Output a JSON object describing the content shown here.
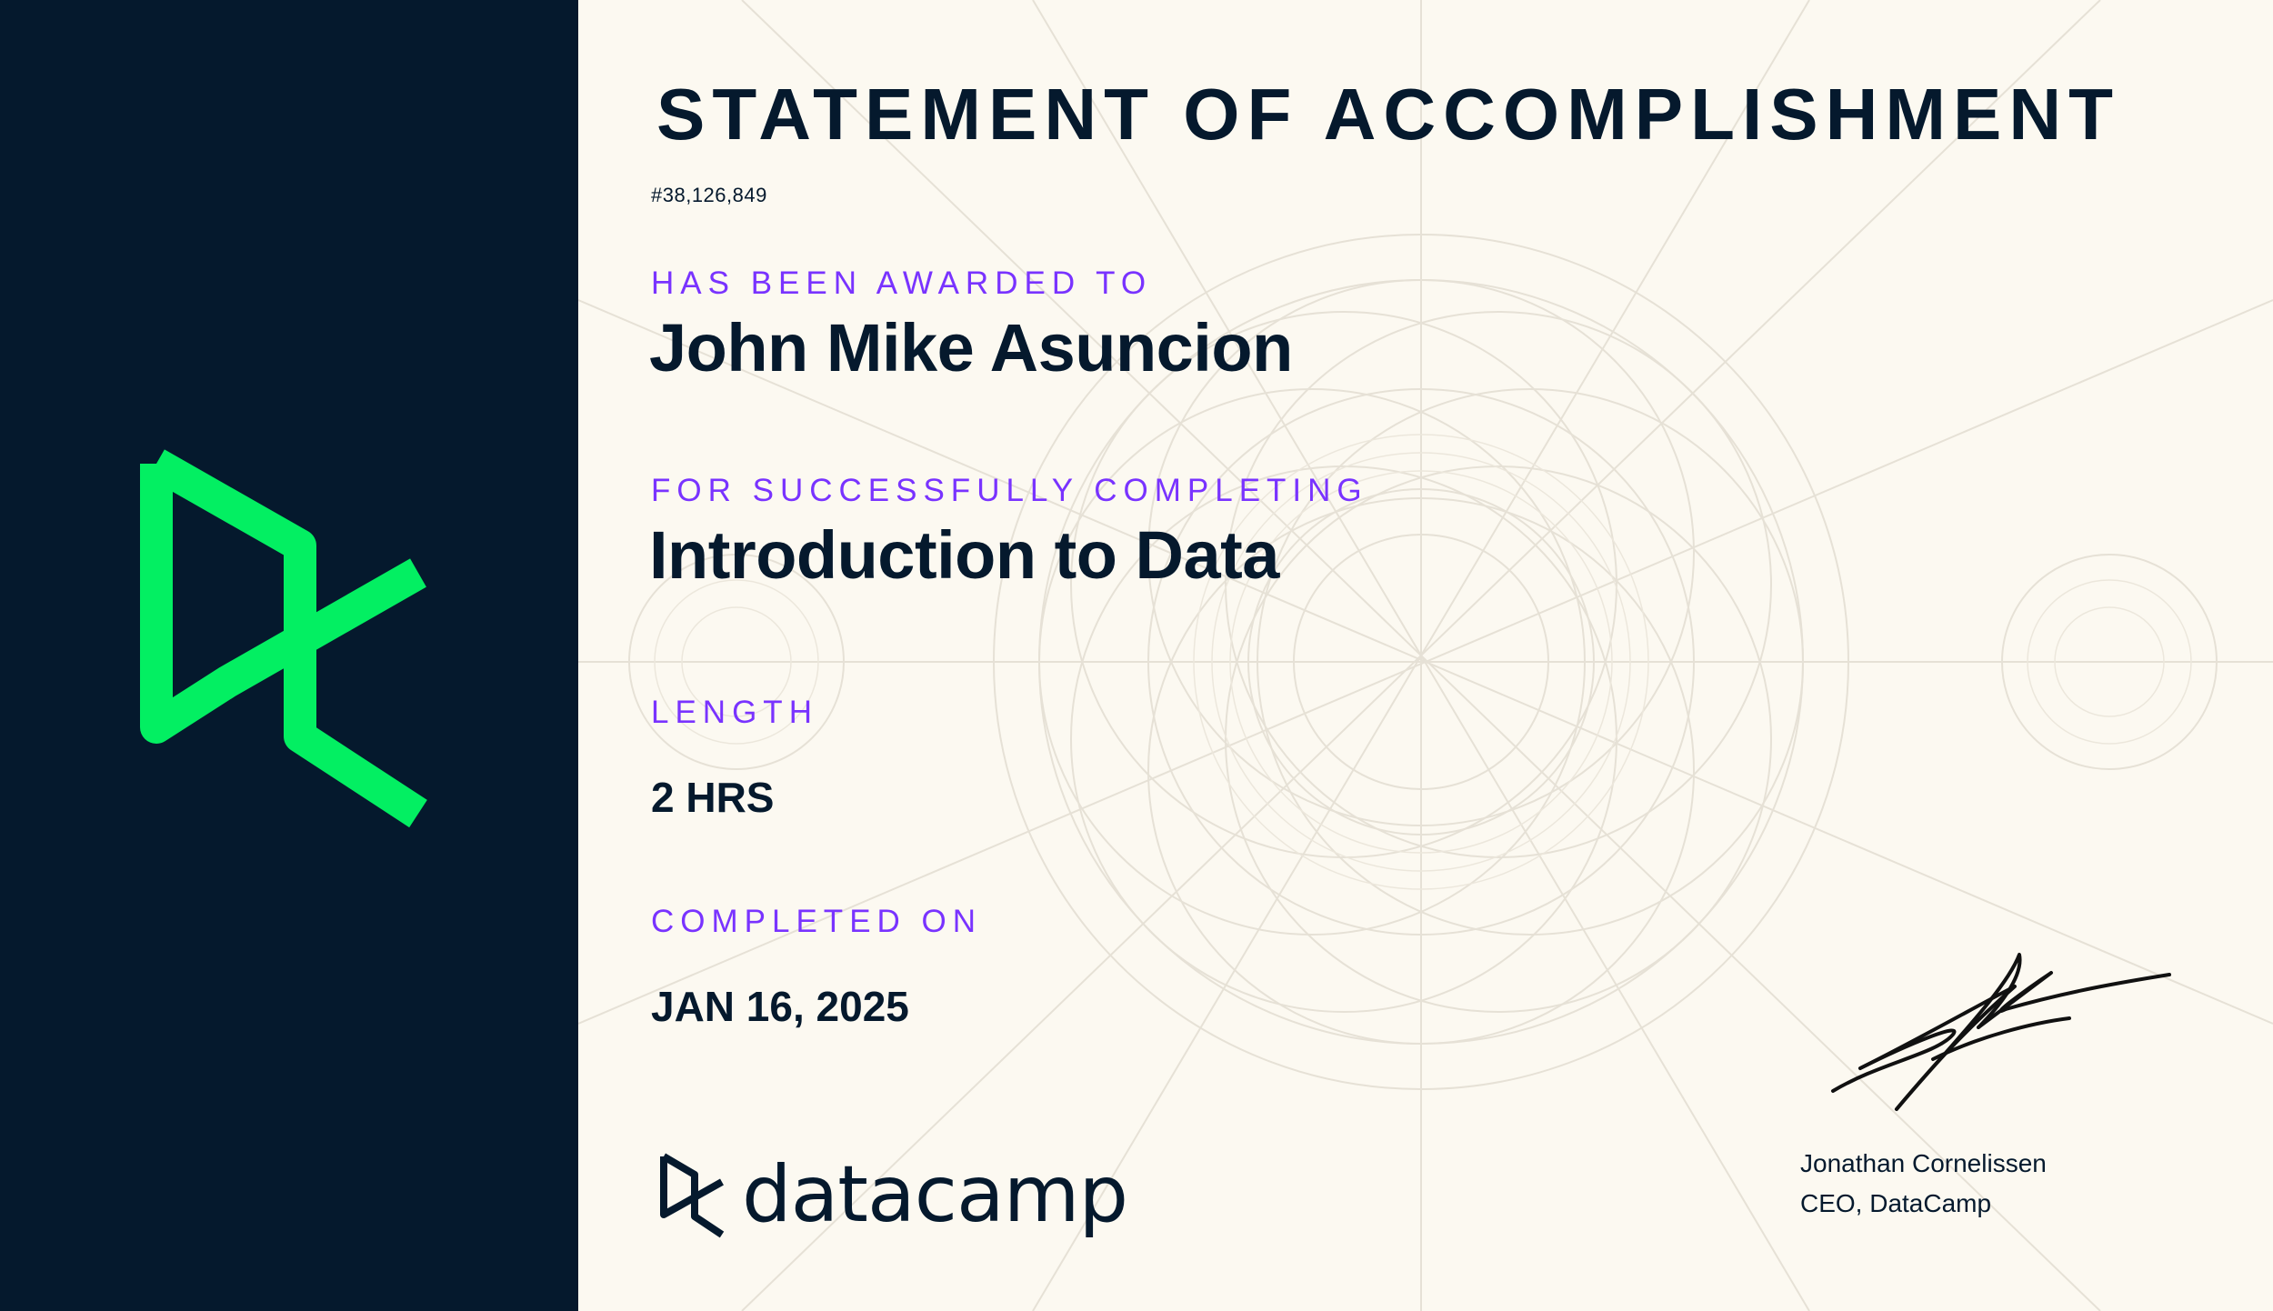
{
  "certificate": {
    "title": "STATEMENT OF ACCOMPLISHMENT",
    "id": "#38,126,849",
    "awarded_label": "HAS BEEN AWARDED TO",
    "recipient": "John Mike Asuncion",
    "completing_label": "FOR SUCCESSFULLY COMPLETING",
    "course": "Introduction to Data",
    "length_label": "LENGTH",
    "length": "2 HRS",
    "completed_label": "COMPLETED ON",
    "completed_date": "JAN 16, 2025"
  },
  "brand": {
    "wordmark": "datacamp",
    "logo_icon": "datacamp-logo-icon"
  },
  "signatory": {
    "name": "Jonathan Cornelissen",
    "title": "CEO, DataCamp"
  },
  "colors": {
    "navy": "#05192d",
    "accent_green": "#03ef62",
    "accent_purple": "#7933ff",
    "paper": "#fcf9f1"
  }
}
